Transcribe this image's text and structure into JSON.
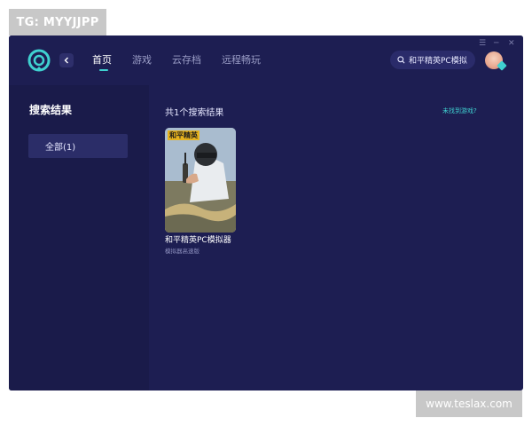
{
  "watermarks": {
    "top_left": "TG: MYYJJPP",
    "bottom_right": "www.teslax.com"
  },
  "header": {
    "nav": [
      {
        "label": "首页",
        "active": true
      },
      {
        "label": "游戏",
        "active": false
      },
      {
        "label": "云存档",
        "active": false
      },
      {
        "label": "远程畅玩",
        "active": false
      }
    ],
    "search": {
      "value": "和平精英PC模拟"
    },
    "window_controls": [
      "menu-icon",
      "minimize-icon",
      "close-icon"
    ]
  },
  "sidebar": {
    "title": "搜索结果",
    "filters": [
      {
        "label": "全部(1)",
        "selected": true
      }
    ]
  },
  "main": {
    "result_count": "共1个搜索结果",
    "not_found_link": "未找到游戏?",
    "results": [
      {
        "cover_title": "和平精英",
        "name": "和平精英PC模拟器",
        "subtitle": "模拟器高速版"
      }
    ]
  },
  "colors": {
    "background": "#1d1e52",
    "sidebar": "#1a1b4a",
    "accent": "#3fd1d0"
  }
}
